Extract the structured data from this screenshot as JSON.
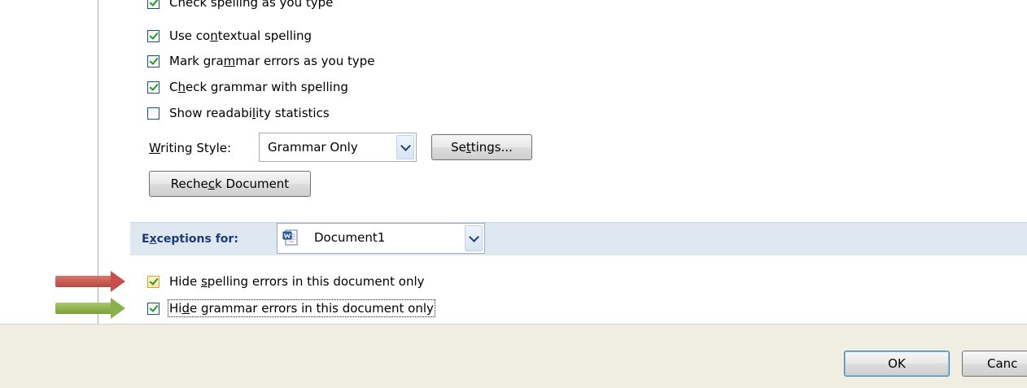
{
  "options": {
    "check_spelling": "Check spelling as you type",
    "contextual_spelling_pre": "Use co",
    "contextual_spelling_key": "n",
    "contextual_spelling_post": "textual spelling",
    "mark_grammar_pre": "Mark gra",
    "mark_grammar_key": "m",
    "mark_grammar_post": "mar errors as you type",
    "check_grammar_pre": "C",
    "check_grammar_key": "h",
    "check_grammar_post": "eck grammar with spelling",
    "readability_pre": "Show readabi",
    "readability_key": "l",
    "readability_post": "ity statistics"
  },
  "writing_style": {
    "label_key": "W",
    "label_post": "riting Style:",
    "value": "Grammar Only",
    "settings_pre": "Se",
    "settings_key": "t",
    "settings_post": "tings..."
  },
  "recheck": {
    "pre": "Reche",
    "key": "c",
    "post": "k Document"
  },
  "exceptions": {
    "label_pre": "E",
    "label_key": "x",
    "label_post": "ceptions for:",
    "document": "Document1",
    "hide_spelling_pre": "Hide ",
    "hide_spelling_key": "s",
    "hide_spelling_post": "pelling errors in this document only",
    "hide_grammar_pre": "Hi",
    "hide_grammar_key": "d",
    "hide_grammar_post": "e grammar errors in this document only"
  },
  "footer": {
    "ok": "OK",
    "cancel": "Canc"
  },
  "colors": {
    "red_arrow": "#c8504a",
    "green_arrow": "#8cb04a",
    "exceptions_bar": "#dfe7f1",
    "footer": "#f0eee1"
  }
}
